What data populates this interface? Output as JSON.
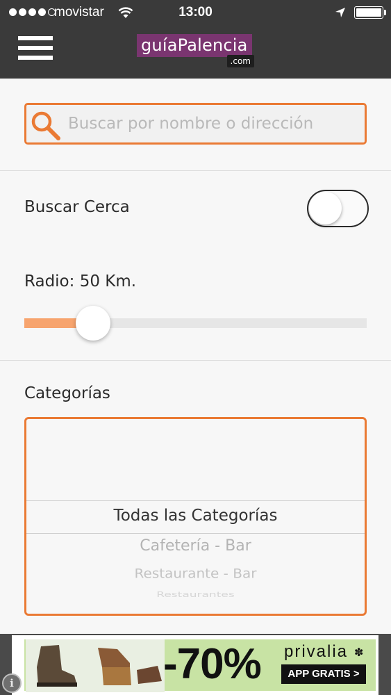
{
  "status_bar": {
    "carrier": "movistar",
    "time": "13:00",
    "signal_icon": "signal-dots-icon",
    "wifi_icon": "wifi-icon",
    "location_icon": "location-arrow-icon",
    "battery_icon": "battery-icon"
  },
  "header": {
    "logo_main": "guíaPalencia",
    "logo_suffix": ".com",
    "menu_icon": "hamburger-menu-icon"
  },
  "search": {
    "placeholder": "Buscar por nombre o dirección",
    "value": "",
    "icon": "search-icon"
  },
  "nearby": {
    "label": "Buscar Cerca",
    "enabled": false
  },
  "radius": {
    "label": "Radio: 50 Km.",
    "slider_fraction": 0.2
  },
  "categories": {
    "label": "Categorías",
    "selected": "Todas las Categorías",
    "options": [
      "Cafetería - Bar",
      "Restaurante - Bar",
      "Restaurantes"
    ]
  },
  "ad": {
    "discount": "-70%",
    "brand": "privalia",
    "cta": "APP GRATIS >",
    "info_icon": "info-icon"
  },
  "colors": {
    "accent": "#ea7a34",
    "header_bg": "#3a3a3a",
    "logo_bg": "#7a3570",
    "slider_fill": "#f7a46e"
  }
}
